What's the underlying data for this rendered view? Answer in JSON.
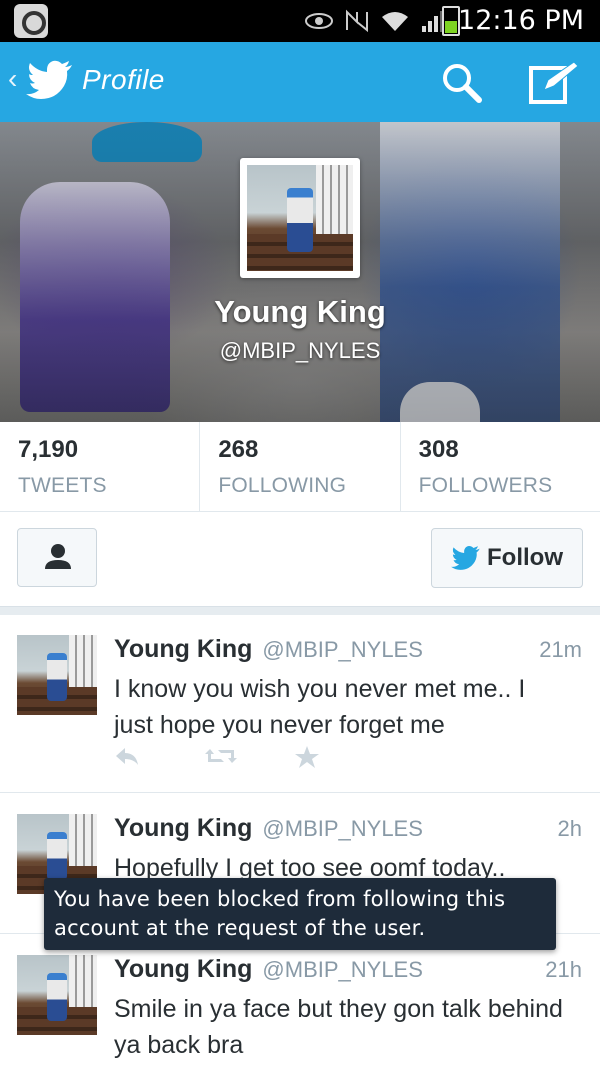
{
  "status_bar": {
    "time": "12:16 PM",
    "icons": [
      "app-icon",
      "eye-icon",
      "nfc-icon",
      "wifi-icon",
      "signal-icon",
      "battery-icon"
    ]
  },
  "action_bar": {
    "title": "Profile",
    "icons": [
      "back-chevron-icon",
      "bird-logo-icon",
      "search-icon",
      "compose-icon"
    ],
    "color": "#26a7e2"
  },
  "profile": {
    "name": "Young King",
    "handle": "@MBIP_NYLES"
  },
  "stats": [
    {
      "value": "7,190",
      "label": "TWEETS"
    },
    {
      "value": "268",
      "label": "FOLLOWING"
    },
    {
      "value": "308",
      "label": "FOLLOWERS"
    }
  ],
  "buttons": {
    "follow_label": "Follow",
    "user_icon": "user-icon"
  },
  "tweets": [
    {
      "name": "Young King",
      "handle": "@MBIP_NYLES",
      "time": "21m",
      "text": "I know you wish you never met me.. I just hope you never forget me"
    },
    {
      "name": "Young King",
      "handle": "@MBIP_NYLES",
      "time": "2h",
      "text": "Hopefully I get too see oomf today.."
    },
    {
      "name": "Young King",
      "handle": "@MBIP_NYLES",
      "time": "21h",
      "text": "Smile in ya face but they gon talk behind ya back bra"
    }
  ],
  "toast": {
    "message": "You have been blocked from following this account at the request of the user."
  }
}
